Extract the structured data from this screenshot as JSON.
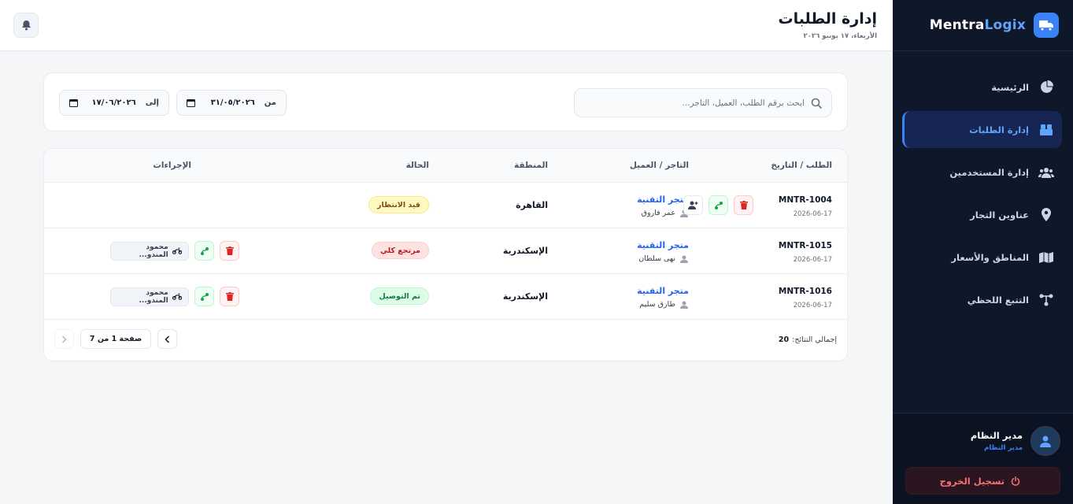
{
  "brand": {
    "name_part1": "Mentra",
    "name_part2": "Logix"
  },
  "sidebar": {
    "items": [
      {
        "label": "الرئيسية",
        "icon": "pie-chart-icon",
        "active": false
      },
      {
        "label": "إدارة الطلبات",
        "icon": "boxes-icon",
        "active": true
      },
      {
        "label": "إدارة المستخدمين",
        "icon": "users-icon",
        "active": false
      },
      {
        "label": "عناوين التجار",
        "icon": "map-pin-icon",
        "active": false
      },
      {
        "label": "المناطق والأسعار",
        "icon": "map-icon",
        "active": false
      },
      {
        "label": "التتبع اللحظي",
        "icon": "route-icon",
        "active": false
      }
    ],
    "user": {
      "name": "مدير النظام",
      "role": "مدير النظام"
    },
    "logout_label": "تسجيل الخروج"
  },
  "header": {
    "title": "إدارة الطلبات",
    "date": "الأربعاء، ١٧ يونيو ٢٠٢٦"
  },
  "filters": {
    "search_placeholder": "ابحث برقم الطلب، العميل، التاجر...",
    "from_label": "من",
    "from_value": "٣١/٠٥/٢٠٢٦",
    "to_label": "إلى",
    "to_value": "١٧/٠٦/٢٠٢٦"
  },
  "table": {
    "columns": {
      "order": "الطلب / التاريخ",
      "merchant": "التاجر / العميل",
      "region": "المنطقة",
      "status": "الحالة",
      "actions": "الإجراءات"
    },
    "rows": [
      {
        "id": "MNTR-1004",
        "date": "2026-06-17",
        "merchant": "متجر التقنية",
        "customer": "عمر فاروق",
        "region": "القاهرة",
        "status": "قيد الانتظار",
        "driver": ""
      },
      {
        "id": "MNTR-1015",
        "date": "2026-06-17",
        "merchant": "متجر التقنية",
        "customer": "نهى سلطان",
        "region": "الإسكندرية",
        "status": "مرتجع كلي",
        "driver": "محمود المندو..."
      },
      {
        "id": "MNTR-1016",
        "date": "2026-06-17",
        "merchant": "متجر التقنية",
        "customer": "طارق سليم",
        "region": "الإسكندرية",
        "status": "تم التوصيل",
        "driver": "محمود المندو..."
      }
    ],
    "total_label": "إجمالي النتائج:",
    "total_value": "20",
    "page_info": "صفحة 1 من 7"
  },
  "colors": {
    "sidebar_bg": "#0f172a",
    "accent": "#3b82f6",
    "danger": "#ef4444",
    "success": "#16a34a"
  }
}
